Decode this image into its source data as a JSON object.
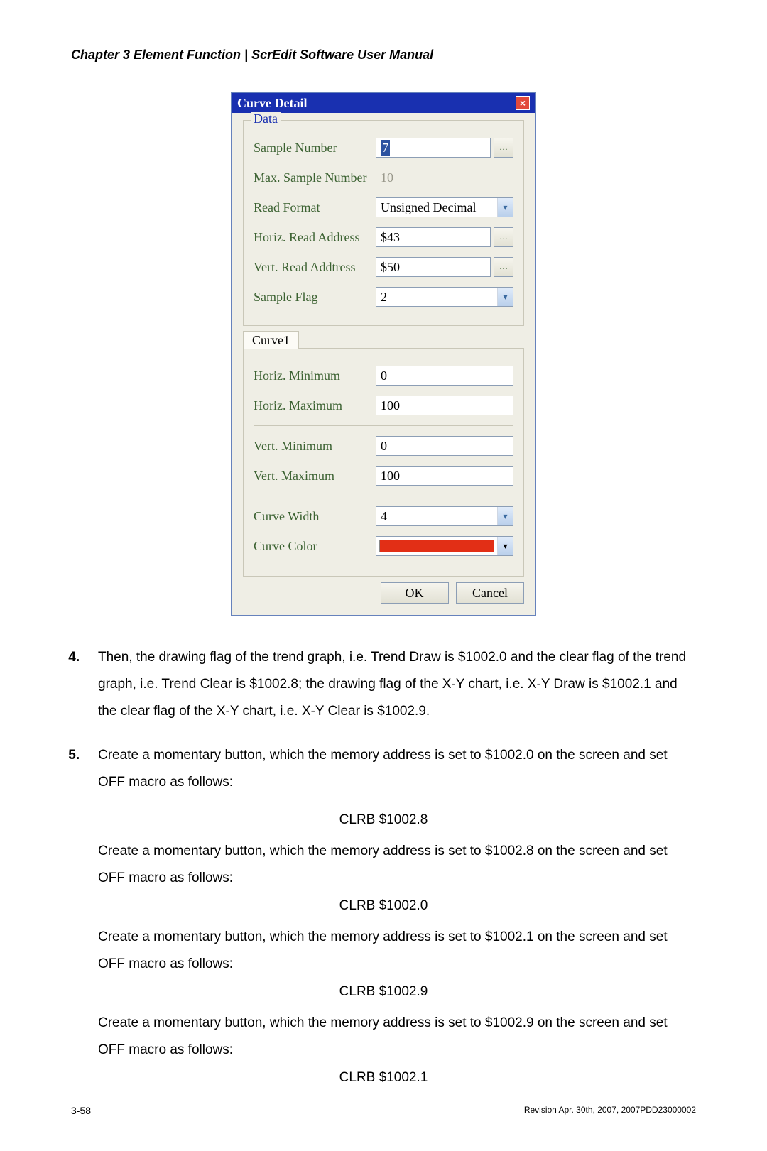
{
  "header": "Chapter 3  Element Function | ScrEdit Software User Manual",
  "dialog": {
    "title": "Curve Detail",
    "legend": "Data",
    "labels": {
      "sample_number": "Sample Number",
      "max_sample": "Max. Sample Number",
      "read_format": "Read Format",
      "horiz_addr": "Horiz. Read Address",
      "vert_addr": "Vert. Read Addtress",
      "sample_flag": "Sample Flag"
    },
    "values": {
      "sample_number": "7",
      "max_sample": "10",
      "read_format": "Unsigned Decimal",
      "horiz_addr": "$43",
      "vert_addr": "$50",
      "sample_flag": "2"
    },
    "tab": {
      "name": "Curve1",
      "labels": {
        "h_min": "Horiz. Minimum",
        "h_max": "Horiz. Maximum",
        "v_min": "Vert. Minimum",
        "v_max": "Vert. Maximum",
        "width": "Curve Width",
        "color": "Curve Color"
      },
      "values": {
        "h_min": "0",
        "h_max": "100",
        "v_min": "0",
        "v_max": "100",
        "width": "4",
        "color": "#e22f16"
      }
    },
    "buttons": {
      "ok": "OK",
      "cancel": "Cancel"
    }
  },
  "body": {
    "item4": "Then, the drawing flag of the trend graph, i.e. Trend Draw is $1002.0 and the clear flag of the trend graph, i.e. Trend Clear is $1002.8; the drawing flag of the X-Y chart, i.e. X-Y Draw is $1002.1 and the clear flag of the X-Y chart, i.e. X-Y Clear is $1002.9.",
    "item5_intro": "Create a momentary button, which the memory address is set to $1002.0 on the screen and set OFF macro as follows:",
    "clrb_1": "CLRB $1002.8",
    "p2": "Create a momentary button, which the memory address is set to $1002.8 on the screen and set OFF macro as follows:",
    "clrb_2": "CLRB $1002.0",
    "p3": "Create a momentary button, which the memory address is set to $1002.1 on the screen and set OFF macro as follows:",
    "clrb_3": "CLRB $1002.9",
    "p4": "Create a momentary button, which the memory address is set to $1002.9 on the screen and set OFF macro as follows:",
    "clrb_4": "CLRB $1002.1"
  },
  "footer": {
    "page": "3-58",
    "rev": "Revision Apr. 30th, 2007, 2007PDD23000002"
  }
}
